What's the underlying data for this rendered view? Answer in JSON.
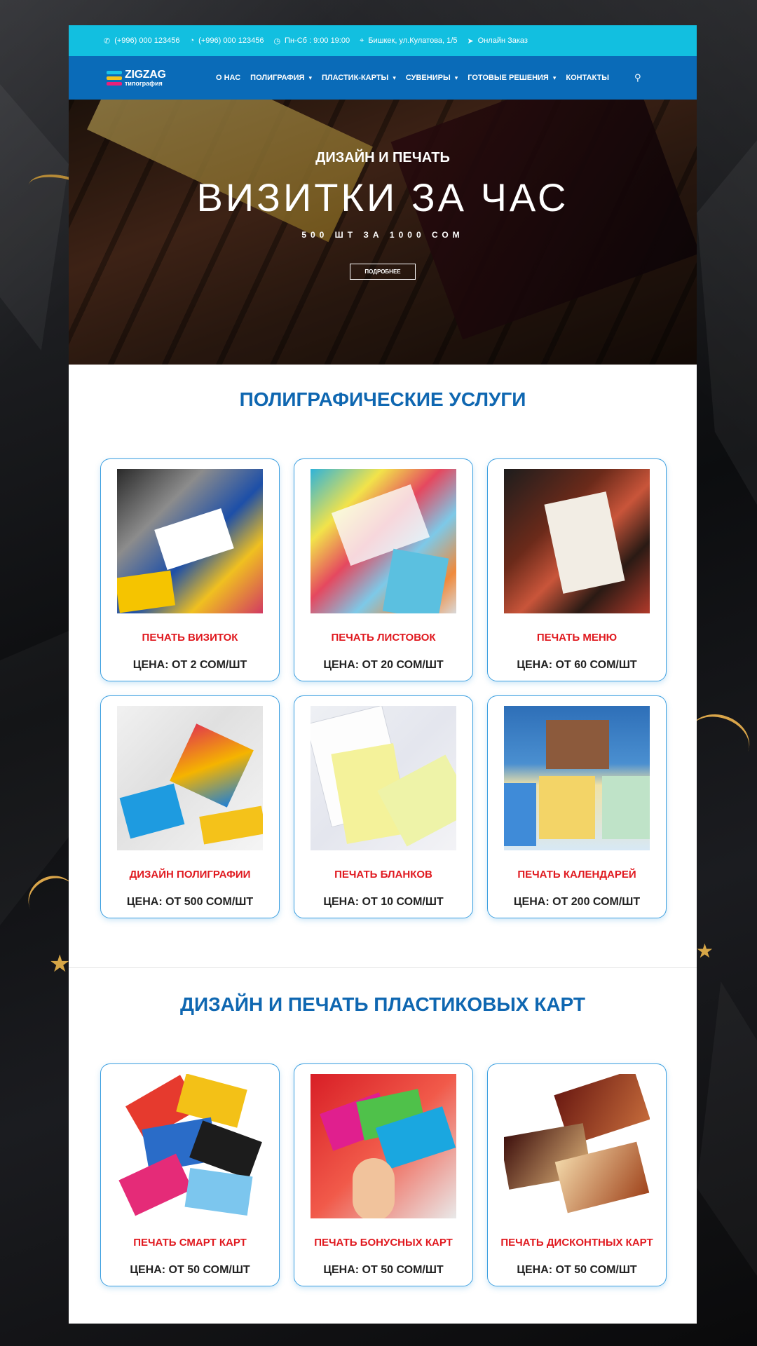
{
  "topbar": {
    "phone1": "(+996) 000 123456",
    "phone2": "(+996) 000 123456",
    "hours": "Пн-Сб : 9:00 19:00",
    "address": "Бишкек, ул.Кулатова, 1/5",
    "order": "Онлайн Заказ"
  },
  "logo": {
    "title": "ZIGZAG",
    "subtitle": "типография"
  },
  "nav": {
    "items": [
      "О НАС",
      "ПОЛИГРАФИЯ",
      "ПЛАСТИК-КАРТЫ",
      "СУВЕНИРЫ",
      "ГОТОВЫЕ РЕШЕНИЯ",
      "КОНТАКТЫ"
    ]
  },
  "hero": {
    "subtitle": "ДИЗАЙН И ПЕЧАТЬ",
    "title": "ВИЗИТКИ ЗА ЧАС",
    "price": "500 ШТ ЗА 1000 СОМ",
    "button": "ПОДРОБНЕЕ"
  },
  "sections": [
    {
      "title": "ПОЛИГРАФИЧЕСКИЕ УСЛУГИ",
      "items": [
        {
          "name": "ПЕЧАТЬ ВИЗИТОК",
          "price": "ЦЕНА: ОТ 2 СОМ/ШТ"
        },
        {
          "name": "ПЕЧАТЬ ЛИСТОВОК",
          "price": "ЦЕНА: ОТ 20 СОМ/ШТ"
        },
        {
          "name": "ПЕЧАТЬ МЕНЮ",
          "price": "ЦЕНА: ОТ 60 СОМ/ШТ"
        },
        {
          "name": "ДИЗАЙН ПОЛИГРАФИИ",
          "price": "ЦЕНА: ОТ 500 СОМ/ШТ"
        },
        {
          "name": "ПЕЧАТЬ БЛАНКОВ",
          "price": "ЦЕНА: ОТ 10 СОМ/ШТ"
        },
        {
          "name": "ПЕЧАТЬ КАЛЕНДАРЕЙ",
          "price": "ЦЕНА: ОТ 200 СОМ/ШТ"
        }
      ]
    },
    {
      "title": "ДИЗАЙН И ПЕЧАТЬ ПЛАСТИКОВЫХ КАРТ",
      "items": [
        {
          "name": "ПЕЧАТЬ СМАРТ КАРТ",
          "price": "ЦЕНА: ОТ 50 СОМ/ШТ"
        },
        {
          "name": "ПЕЧАТЬ БОНУСНЫХ КАРТ",
          "price": "ЦЕНА: ОТ 50 СОМ/ШТ"
        },
        {
          "name": "ПЕЧАТЬ ДИСКОНТНЫХ КАРТ",
          "price": "ЦЕНА: ОТ 50 СОМ/ШТ"
        }
      ]
    }
  ],
  "colors": {
    "topbar": "#12bfe0",
    "nav": "#0a6bb8",
    "section_title": "#0f67b1",
    "service_name": "#e0191f",
    "card_border": "#3c9fe0"
  },
  "icons": [
    "phone-icon",
    "whatsapp-icon",
    "clock-icon",
    "location-icon",
    "paper-plane-icon",
    "chevron-down-icon",
    "search-icon"
  ]
}
